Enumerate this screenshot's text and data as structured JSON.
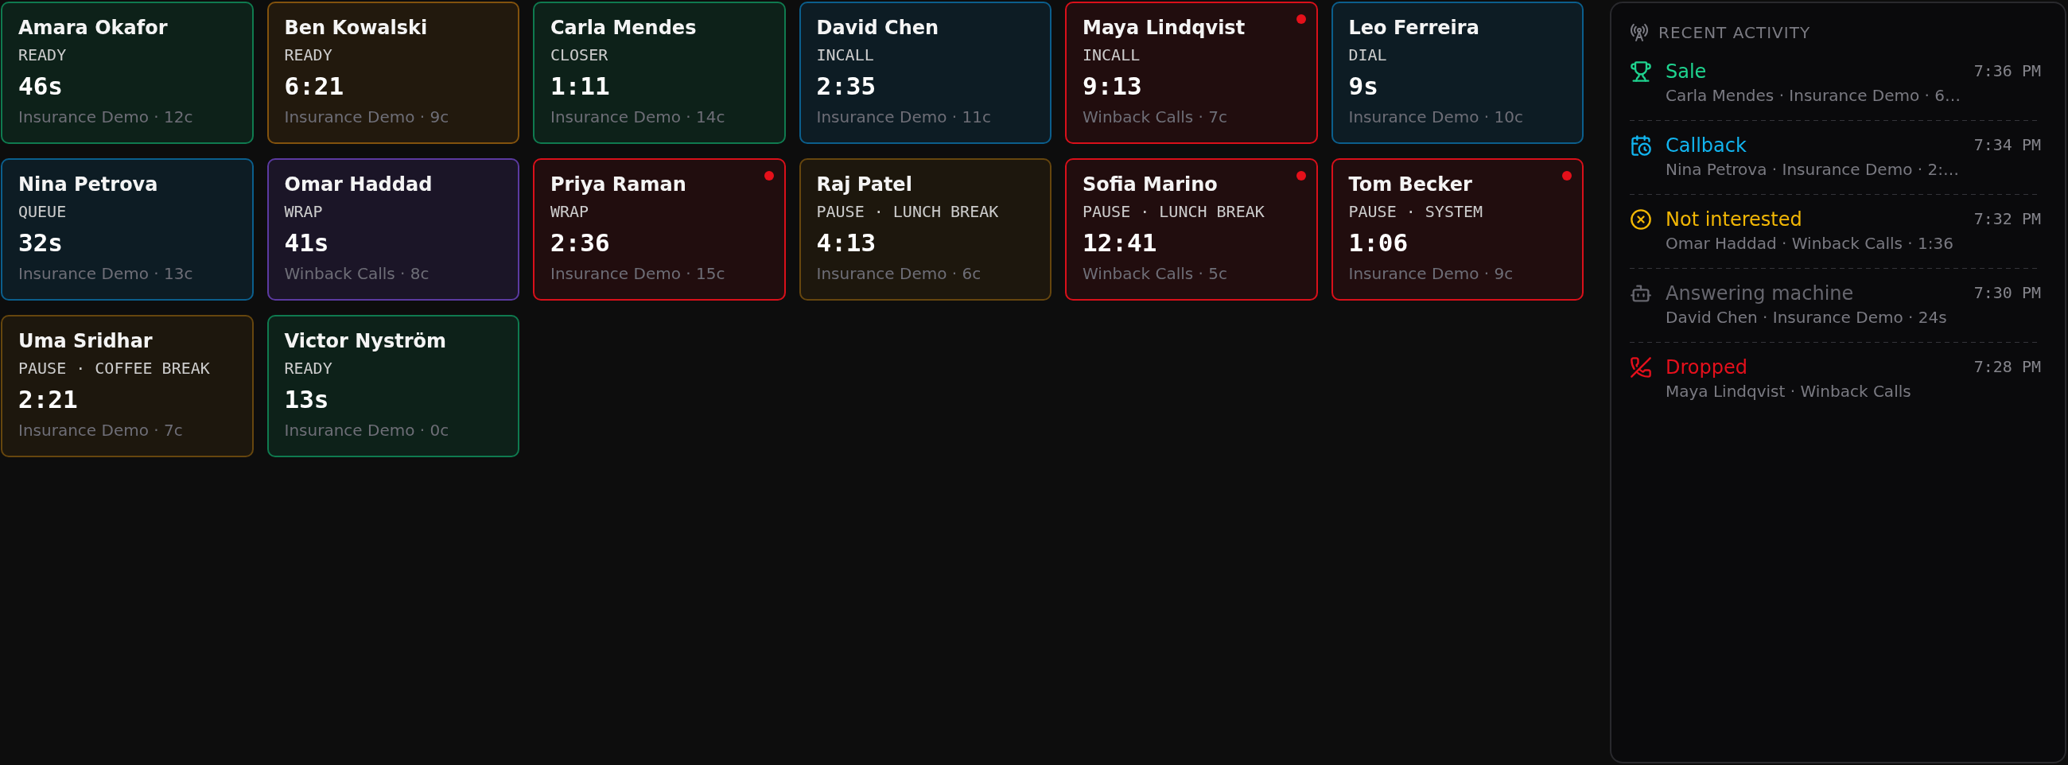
{
  "cards": [
    {
      "name": "Amara Okafor",
      "status": "READY",
      "timer": "46s",
      "meta": "Insurance Demo · 12c",
      "color": "#0f7a4f",
      "alert": false
    },
    {
      "name": "Ben Kowalski",
      "status": "READY",
      "timer": "6:21",
      "meta": "Insurance Demo · 9c",
      "color": "#82520d",
      "alert": false
    },
    {
      "name": "Carla Mendes",
      "status": "CLOSER",
      "timer": "1:11",
      "meta": "Insurance Demo · 14c",
      "color": "#0f7a4f",
      "alert": false
    },
    {
      "name": "David Chen",
      "status": "INCALL",
      "timer": "2:35",
      "meta": "Insurance Demo · 11c",
      "color": "#0b5e8c",
      "alert": false
    },
    {
      "name": "Maya Lindqvist",
      "status": "INCALL",
      "timer": "9:13",
      "meta": "Winback Calls · 7c",
      "color": "#d9101a",
      "alert": true
    },
    {
      "name": "Leo Ferreira",
      "status": "DIAL",
      "timer": "9s",
      "meta": "Insurance Demo · 10c",
      "color": "#0b5e8c",
      "alert": false
    },
    {
      "name": "Nina Petrova",
      "status": "QUEUE",
      "timer": "32s",
      "meta": "Insurance Demo · 13c",
      "color": "#0b5e8c",
      "alert": false
    },
    {
      "name": "Omar Haddad",
      "status": "WRAP",
      "timer": "41s",
      "meta": "Winback Calls · 8c",
      "color": "#5b3aa0",
      "alert": false
    },
    {
      "name": "Priya Raman",
      "status": "WRAP",
      "timer": "2:36",
      "meta": "Insurance Demo · 15c",
      "color": "#d9101a",
      "alert": true
    },
    {
      "name": "Raj Patel",
      "status": "PAUSE · LUNCH BREAK",
      "timer": "4:13",
      "meta": "Insurance Demo · 6c",
      "color": "#66460e",
      "alert": false
    },
    {
      "name": "Sofia Marino",
      "status": "PAUSE · LUNCH BREAK",
      "timer": "12:41",
      "meta": "Winback Calls · 5c",
      "color": "#d9101a",
      "alert": true
    },
    {
      "name": "Tom Becker",
      "status": "PAUSE · SYSTEM",
      "timer": "1:06",
      "meta": "Insurance Demo · 9c",
      "color": "#d9101a",
      "alert": true
    },
    {
      "name": "Uma Sridhar",
      "status": "PAUSE · COFFEE BREAK",
      "timer": "2:21",
      "meta": "Insurance Demo · 7c",
      "color": "#66460e",
      "alert": false
    },
    {
      "name": "Victor Nyström",
      "status": "READY",
      "timer": "13s",
      "meta": "Insurance Demo · 0c",
      "color": "#0f7a4f",
      "alert": false
    }
  ],
  "activity": {
    "title": "RECENT ACTIVITY",
    "items": [
      {
        "kind": "sale",
        "title": "Sale",
        "detail": "Carla Mendes · Insurance Demo · 6…",
        "time": "7:36 PM",
        "color": "#1fd38f"
      },
      {
        "kind": "callback",
        "title": "Callback",
        "detail": "Nina Petrova · Insurance Demo · 2:…",
        "time": "7:34 PM",
        "color": "#12b5f0"
      },
      {
        "kind": "not_interested",
        "title": "Not interested",
        "detail": "Omar Haddad · Winback Calls · 1:36",
        "time": "7:32 PM",
        "color": "#f2b705"
      },
      {
        "kind": "answering_machine",
        "title": "Answering machine",
        "detail": "David Chen · Insurance Demo · 24s",
        "time": "7:30 PM",
        "color": "#66666e"
      },
      {
        "kind": "dropped",
        "title": "Dropped",
        "detail": "Maya Lindqvist · Winback Calls",
        "time": "7:28 PM",
        "color": "#e5101c"
      }
    ]
  }
}
